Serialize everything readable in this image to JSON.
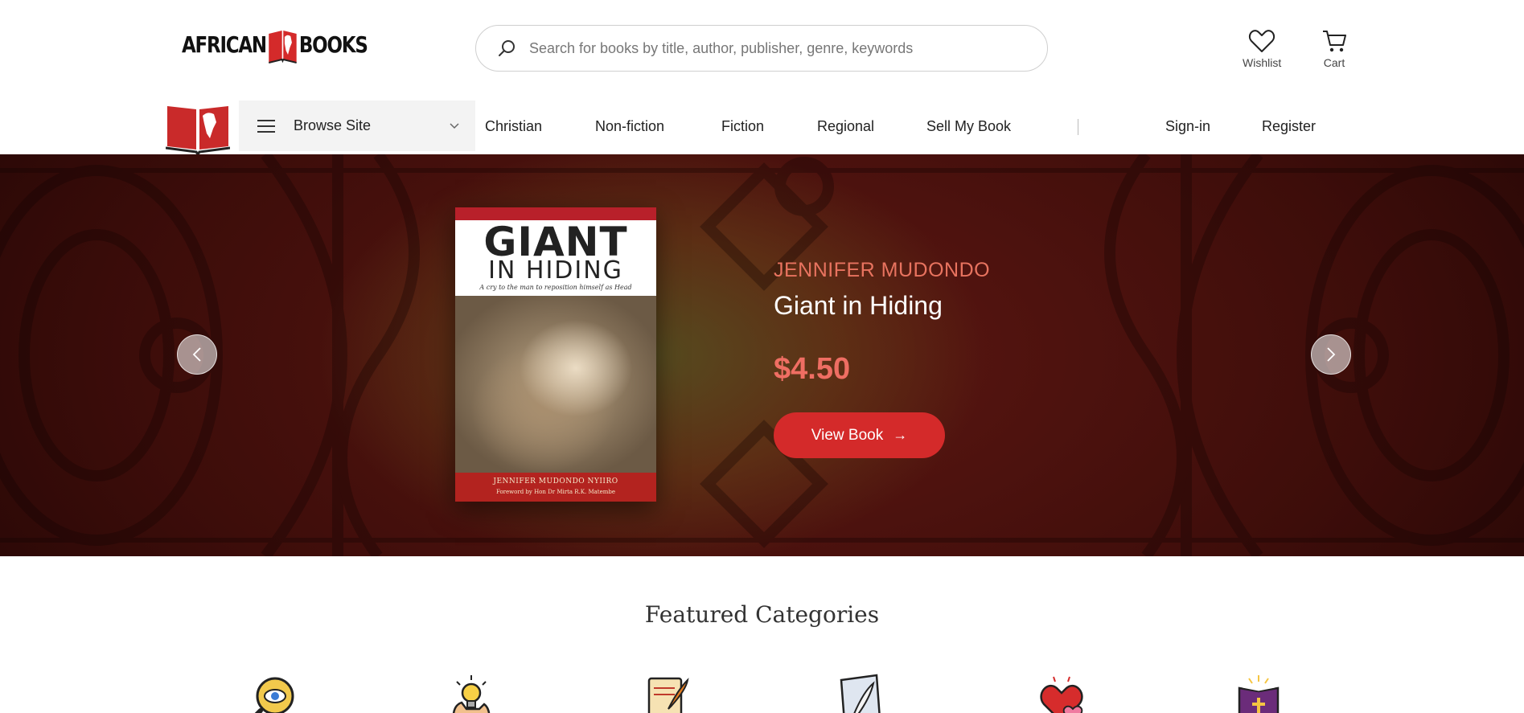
{
  "header": {
    "logo_text_left": "AFRICAN",
    "logo_text_right": "BOOKS",
    "search_placeholder": "Search for books by title, author, publisher, genre, keywords",
    "wishlist_label": "Wishlist",
    "cart_label": "Cart"
  },
  "nav": {
    "browse_label": "Browse Site",
    "links": [
      "Christian",
      "Non-fiction",
      "Fiction",
      "Regional",
      "Sell My Book"
    ],
    "sign_in": "Sign-in",
    "register": "Register"
  },
  "hero": {
    "author": "JENNIFER MUDONDO",
    "title": "Giant in Hiding",
    "price": "$4.50",
    "button_label": "View Book",
    "button_arrow": "→",
    "cover": {
      "title_line1": "GIANT",
      "title_line2": "IN HIDING",
      "subtitle": "A cry to the man to reposition himself as Head",
      "author": "JENNIFER MUDONDO NYIIRO",
      "foreword": "Foreword by Hon Dr Mirta R.K. Matembe"
    }
  },
  "featured": {
    "title": "Featured Categories",
    "icons": [
      "magnifier-eye-icon",
      "lightbulb-hand-icon",
      "scroll-quill-icon",
      "paper-quill-icon",
      "hearts-icon",
      "bible-icon"
    ]
  },
  "colors": {
    "accent_red": "#d42a2a",
    "price": "#ef6e63",
    "author": "#e8735f"
  }
}
